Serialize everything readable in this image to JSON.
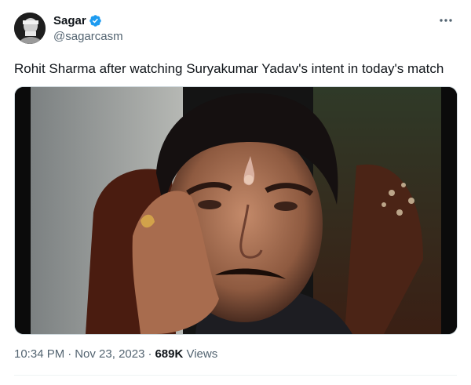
{
  "author": {
    "display_name": "Sagar",
    "handle": "@sagarcasm",
    "verified": true,
    "verified_color": "#1d9bf0"
  },
  "tweet": {
    "text": "Rohit Sharma after watching Suryakumar Yadav's intent in today's match"
  },
  "meta": {
    "time": "10:34 PM",
    "separator": "·",
    "date": "Nov 23, 2023",
    "views_count": "689K",
    "views_label": "Views"
  },
  "icons": {
    "more": "more-options-icon",
    "verified": "verified-badge-icon"
  }
}
